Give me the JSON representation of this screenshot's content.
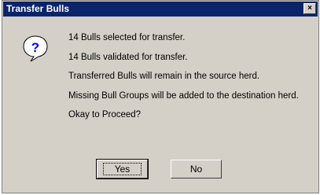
{
  "window": {
    "title": "Transfer Bulls",
    "close_glyph": "×"
  },
  "icon": {
    "name": "question-icon",
    "glyph": "?",
    "color": "#0000ff"
  },
  "messages": [
    "14 Bulls selected for transfer.",
    "14 Bulls validated for transfer.",
    "Transferred Bulls will remain in the source herd.",
    "Missing Bull Groups will be added to the destination herd.",
    "Okay to Proceed?"
  ],
  "buttons": {
    "yes_label": "Yes",
    "no_label": "No"
  }
}
